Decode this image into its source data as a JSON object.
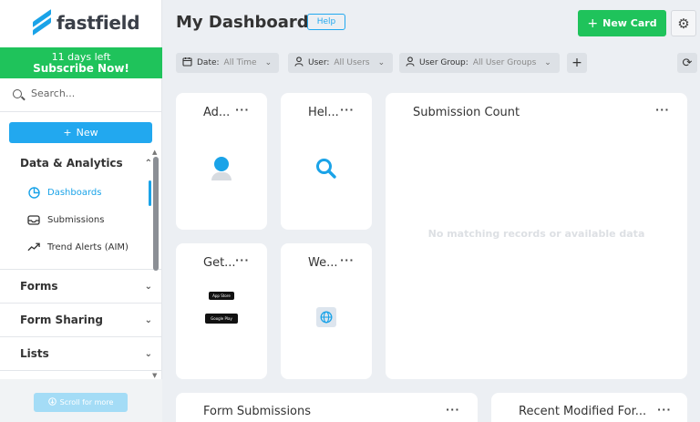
{
  "brand": {
    "name": "fastfield"
  },
  "trial": {
    "line1": "11 days left",
    "line2": "Subscribe Now!"
  },
  "search": {
    "placeholder": "Search..."
  },
  "sidebar": {
    "new_label": "New",
    "sections": [
      {
        "label": "Data & Analytics"
      },
      {
        "label": "Forms"
      },
      {
        "label": "Form Sharing"
      },
      {
        "label": "Lists"
      }
    ],
    "items": [
      {
        "label": "Dashboards"
      },
      {
        "label": "Submissions"
      },
      {
        "label": "Trend Alerts (AIM)"
      }
    ],
    "scroll_more": "Scroll for more"
  },
  "header": {
    "title": "My Dashboard",
    "help_label": "Help",
    "new_card_label": "New Card"
  },
  "filters": [
    {
      "key": "Date:",
      "value": "All Time"
    },
    {
      "key": "User:",
      "value": "All Users"
    },
    {
      "key": "User Group:",
      "value": "All User Groups"
    }
  ],
  "cards": [
    {
      "title": "Ad..."
    },
    {
      "title": "Hel..."
    },
    {
      "title": "Get..."
    },
    {
      "title": "We..."
    },
    {
      "title": "Submission Count",
      "empty_text": "No matching records or available data"
    },
    {
      "title": "Form Submissions"
    },
    {
      "title": "Recent Modified For..."
    }
  ],
  "store_badges": {
    "app_store": "App Store",
    "google_play": "Google Play"
  },
  "colors": {
    "accent_blue": "#1aa3e8",
    "accent_green": "#1fc35b"
  }
}
